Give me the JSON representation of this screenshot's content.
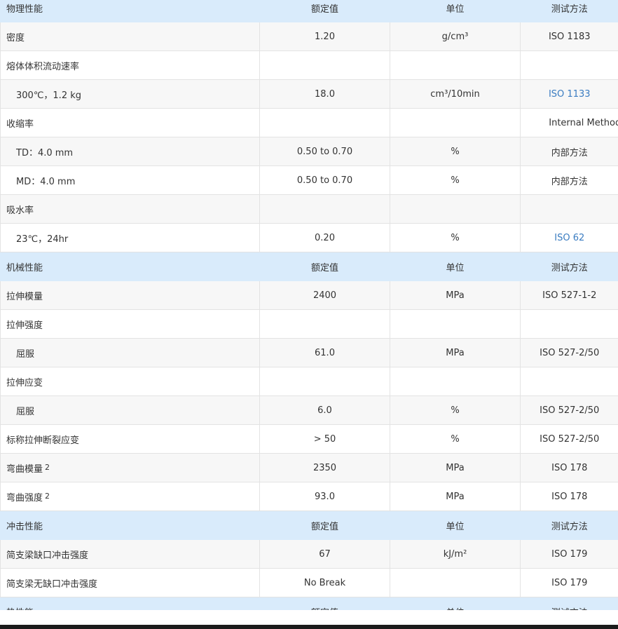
{
  "sections": [
    {
      "header": {
        "name": "物理性能",
        "value": "额定值",
        "unit": "单位",
        "method": "测试方法"
      },
      "rows": [
        {
          "name": "密度",
          "value": "1.20",
          "unit": "g/cm³",
          "method": "ISO 1183"
        },
        {
          "name": "熔体体积流动速率",
          "value": "",
          "unit": "",
          "method": ""
        },
        {
          "name": "300℃，1.2 kg",
          "value": "18.0",
          "unit": "cm³/10min",
          "method": "ISO 1133",
          "indent": true,
          "link": true
        },
        {
          "name": "收缩率",
          "value": "",
          "unit": "",
          "method": "Internal Method",
          "wide": true
        },
        {
          "name": "TD：4.0 mm",
          "value": "0.50 to 0.70",
          "unit": "%",
          "method": "内部方法",
          "indent": true
        },
        {
          "name": "MD：4.0 mm",
          "value": "0.50 to 0.70",
          "unit": "%",
          "method": "内部方法",
          "indent": true
        },
        {
          "name": "吸水率",
          "value": "",
          "unit": "",
          "method": ""
        },
        {
          "name": "23℃，24hr",
          "value": "0.20",
          "unit": "%",
          "method": "ISO 62",
          "indent": true,
          "link": true
        }
      ]
    },
    {
      "header": {
        "name": "机械性能",
        "value": "额定值",
        "unit": "单位",
        "method": "测试方法"
      },
      "rows": [
        {
          "name": "拉伸模量",
          "value": "2400",
          "unit": "MPa",
          "method": "ISO 527-1-2"
        },
        {
          "name": "拉伸强度",
          "value": "",
          "unit": "",
          "method": ""
        },
        {
          "name": "屈服",
          "value": "61.0",
          "unit": "MPa",
          "method": "ISO 527-2/50",
          "indent": true
        },
        {
          "name": "拉伸应变",
          "value": "",
          "unit": "",
          "method": ""
        },
        {
          "name": "屈服",
          "value": "6.0",
          "unit": "%",
          "method": "ISO 527-2/50",
          "indent": true
        },
        {
          "name": "标称拉伸断裂应变",
          "value": "> 50",
          "unit": "%",
          "method": "ISO 527-2/50"
        },
        {
          "name": "弯曲模量",
          "sup": "2",
          "value": "2350",
          "unit": "MPa",
          "method": "ISO 178"
        },
        {
          "name": "弯曲强度",
          "sup": "2",
          "value": "93.0",
          "unit": "MPa",
          "method": "ISO 178"
        }
      ]
    },
    {
      "header": {
        "name": "冲击性能",
        "value": "额定值",
        "unit": "单位",
        "method": "测试方法"
      },
      "rows": [
        {
          "name": "简支梁缺口冲击强度",
          "value": "67",
          "unit": "kJ/m²",
          "method": "ISO 179"
        },
        {
          "name": "简支梁无缺口冲击强度",
          "value": "No Break",
          "unit": "",
          "method": "ISO 179"
        }
      ]
    },
    {
      "header": {
        "name": "热性能",
        "value": "额定值",
        "unit": "单位",
        "method": "测试方法"
      },
      "rows": []
    }
  ]
}
